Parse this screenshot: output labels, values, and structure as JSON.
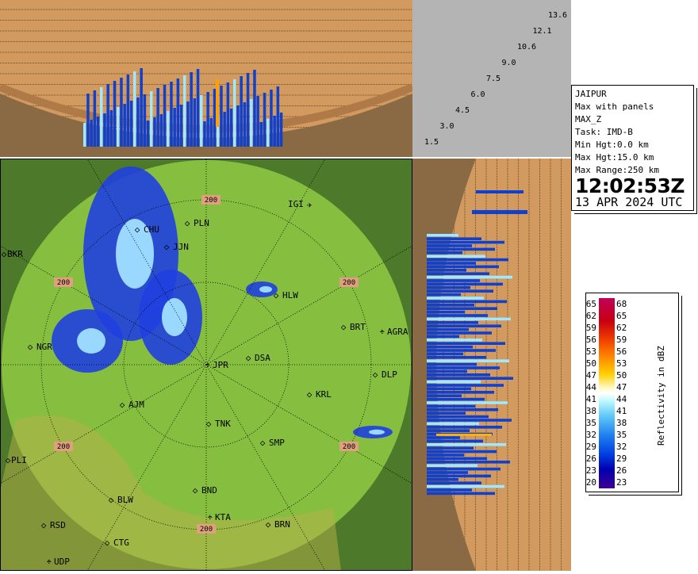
{
  "info": {
    "station": "JAIPUR",
    "product": "Max with panels",
    "product_code": "MAX_Z",
    "task": "Task: IMD-B",
    "min_hgt": "Min Hgt:0.0 km",
    "max_hgt": "Max Hgt:15.0 km",
    "max_range": "Max Range:250 km",
    "time": "12:02:53Z",
    "date": "13 APR 2024 UTC"
  },
  "height_labels": [
    "13.6",
    "12.1",
    "10.6",
    "9.0",
    "7.5",
    "6.0",
    "4.5",
    "3.0",
    "1.5"
  ],
  "legend": {
    "title": "Reflectivity in dBZ",
    "left": [
      "65",
      "62",
      "59",
      "56",
      "53",
      "50",
      "47",
      "44",
      "41",
      "38",
      "35",
      "32",
      "29",
      "26",
      "23",
      "20"
    ],
    "right": [
      "68",
      "65",
      "62",
      "59",
      "56",
      "53",
      "50",
      "47",
      "44",
      "41",
      "38",
      "35",
      "32",
      "29",
      "26",
      "23"
    ]
  },
  "map": {
    "range_label": "200",
    "cities": [
      "IGI",
      "PLN",
      "CHU",
      "JJN",
      "BKR",
      "HLW",
      "BRT",
      "AGRA",
      "NGR",
      "DSA",
      "JPR",
      "DLP",
      "KRL",
      "AJM",
      "TNK",
      "SMP",
      "PLI",
      "BND",
      "BLW",
      "KTA",
      "BRN",
      "RSD",
      "CTG",
      "UDP"
    ],
    "airports": [
      "IGI",
      "AGRA",
      "JPR",
      "KTA",
      "UDP"
    ]
  },
  "colors": {
    "terrain": "#8bc34a",
    "panel": "#d29a5e",
    "ground": "#8a6a44",
    "echo": "#2050f0"
  }
}
